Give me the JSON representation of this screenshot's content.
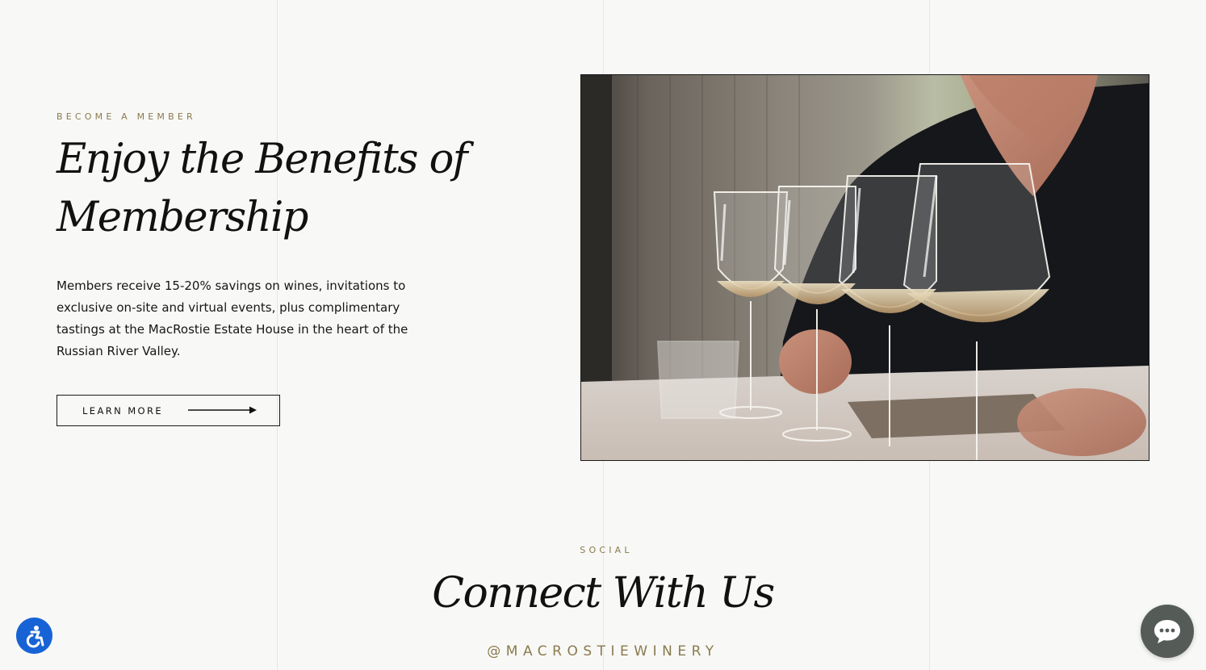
{
  "membership": {
    "eyebrow": "BECOME A MEMBER",
    "title": "Enjoy the Benefits of Membership",
    "body": "Members receive 15-20% savings on wines, invitations to exclusive on-site and virtual events, plus complimentary tastings at the MacRostie Estate House in the heart of the Russian River Valley.",
    "cta_label": "LEARN MORE"
  },
  "social": {
    "eyebrow": "SOCIAL",
    "title": "Connect With Us",
    "handle": "@MACROSTIEWINERY"
  },
  "widgets": {
    "accessibility_icon": "accessibility-icon",
    "chat_icon": "chat-bubble-icon"
  },
  "colors": {
    "background": "#f8f8f6",
    "accent_gold": "#8a7a4e",
    "accessibility_blue": "#1763d6",
    "chat_gray": "#555c57"
  }
}
